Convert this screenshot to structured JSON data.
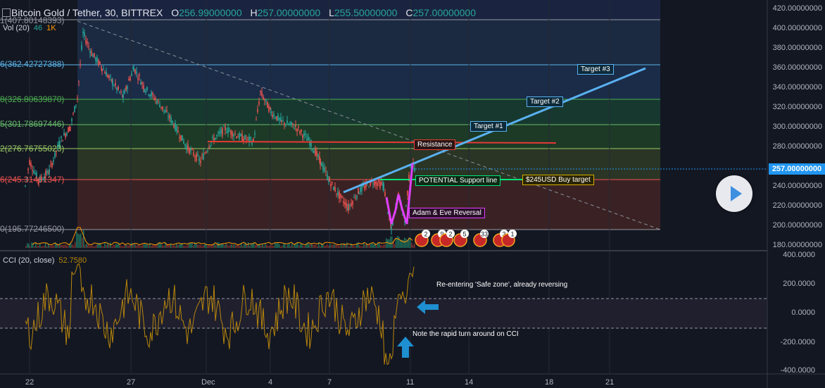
{
  "header": {
    "symbol": "Bitcoin Gold / Tether, 30, BITTREX",
    "open_label": "O",
    "open_value": "256.99000000",
    "high_label": "H",
    "high_value": "257.00000000",
    "low_label": "L",
    "low_value": "255.50000000",
    "close_label": "C",
    "close_value": "257.00000000"
  },
  "volume": {
    "label": "Vol (20)",
    "v1": "46",
    "v2": "1K"
  },
  "fib_levels": [
    {
      "label": "1(407.80148393)",
      "price": 407.80148393,
      "color": "#9598a1"
    },
    {
      "label": "6(362.42727388)",
      "price": 362.42727388,
      "color": "#5ab4e8"
    },
    {
      "label": "8(326.80639870)",
      "price": 326.8063987,
      "color": "#4caf50"
    },
    {
      "label": "5(301.78697446)",
      "price": 301.78697446,
      "color": "#66bb6a"
    },
    {
      "label": "2(276.76755023)",
      "price": 276.76755023,
      "color": "#9ccc65"
    },
    {
      "label": "6(245.31461347)",
      "price": 245.31461347,
      "color": "#ef5350"
    },
    {
      "label": "0(195.77246500)",
      "price": 195.772465,
      "color": "#9598a1"
    }
  ],
  "price_axis": {
    "ticks": [
      "420.00000000",
      "400.00000000",
      "380.00000000",
      "360.00000000",
      "340.00000000",
      "320.00000000",
      "300.00000000",
      "280.00000000",
      "260.00000000",
      "240.00000000",
      "220.00000000",
      "200.00000000",
      "180.00000000"
    ],
    "current": "257.00000000",
    "current_color": "#2196f3"
  },
  "time_axis": {
    "ticks": [
      "22",
      "27",
      "Dec",
      "4",
      "7",
      "11",
      "14",
      "18",
      "21"
    ]
  },
  "cci": {
    "label": "CCI (20, close)",
    "value": "52.7580",
    "ticks": [
      "400.0000",
      "200.0000",
      "0.0000",
      "-200.0000",
      "-400.0000"
    ]
  },
  "annotations": {
    "target3": "Target #3",
    "target2": "Target #2",
    "target1": "Target #1",
    "resistance": "Resistance",
    "support": "POTENTIAL Support line",
    "buy_target": "$245USD Buy target",
    "adam_eve": "Adam & Eve Reversal",
    "safe_zone": "Re-entering 'Safe zone', already reversing",
    "rapid_turn": "Note the rapid turn around on CCI"
  },
  "event_badges": [
    "2",
    "9",
    "2",
    "5",
    "33",
    "3",
    "1"
  ],
  "colors": {
    "background": "#131722",
    "up": "#26a69a",
    "down": "#ef5350",
    "trendline": "#5ab0f0",
    "resistance_line": "#e53935",
    "support_line": "#00e676",
    "cci_line": "#b8860b",
    "pattern": "#e040fb"
  }
}
